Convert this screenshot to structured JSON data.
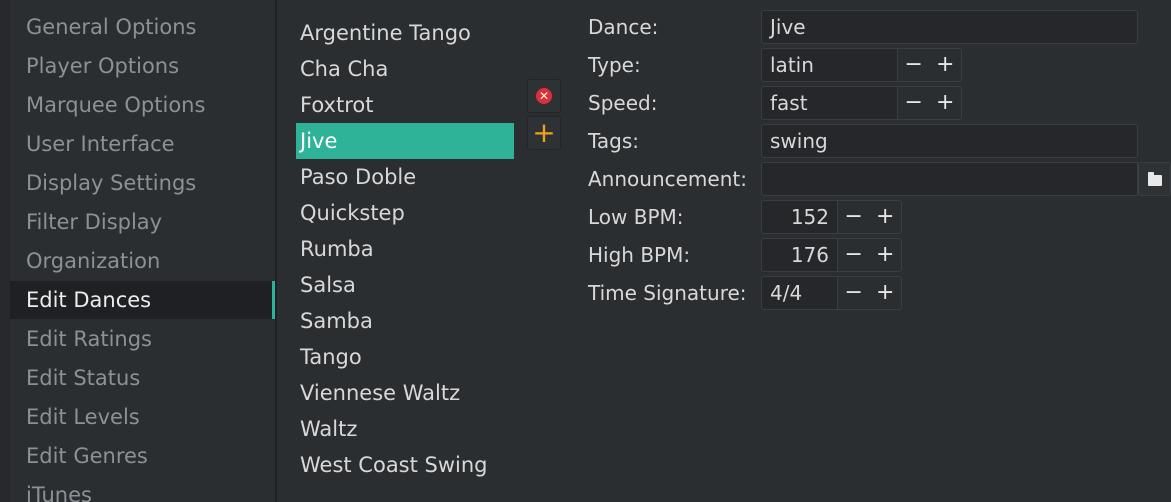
{
  "nav": {
    "items": [
      {
        "label": "General Options"
      },
      {
        "label": "Player Options"
      },
      {
        "label": "Marquee Options"
      },
      {
        "label": "User Interface"
      },
      {
        "label": "Display Settings"
      },
      {
        "label": "Filter Display"
      },
      {
        "label": "Organization"
      },
      {
        "label": "Edit Dances",
        "active": true
      },
      {
        "label": "Edit Ratings"
      },
      {
        "label": "Edit Status"
      },
      {
        "label": "Edit Levels"
      },
      {
        "label": "Edit Genres"
      },
      {
        "label": "iTunes"
      }
    ]
  },
  "dances": {
    "items": [
      "Argentine Tango",
      "Cha Cha",
      "Foxtrot",
      "Jive",
      "Paso Doble",
      "Quickstep",
      "Rumba",
      "Salsa",
      "Samba",
      "Tango",
      "Viennese Waltz",
      "Waltz",
      "West Coast Swing"
    ],
    "selected": "Jive"
  },
  "buttons": {
    "delete_icon": "close-circle-icon",
    "add_icon": "plus-icon",
    "delete_glyph": "✕",
    "add_glyph": "+",
    "colors": {
      "delete": "#e02e36",
      "add": "#f0a21e",
      "accent": "#2eb398"
    }
  },
  "form": {
    "dance": {
      "label": "Dance:",
      "value": "Jive"
    },
    "type": {
      "label": "Type:",
      "value": "latin"
    },
    "speed": {
      "label": "Speed:",
      "value": "fast"
    },
    "tags": {
      "label": "Tags:",
      "value": "swing"
    },
    "announcement": {
      "label": "Announcement:",
      "value": "",
      "icon": "folder-icon"
    },
    "low_bpm": {
      "label": "Low BPM:",
      "value": "152"
    },
    "high_bpm": {
      "label": "High BPM:",
      "value": "176"
    },
    "time_signature": {
      "label": "Time Signature:",
      "value": "4/4"
    },
    "stepper": {
      "minus": "−",
      "plus": "+"
    }
  }
}
